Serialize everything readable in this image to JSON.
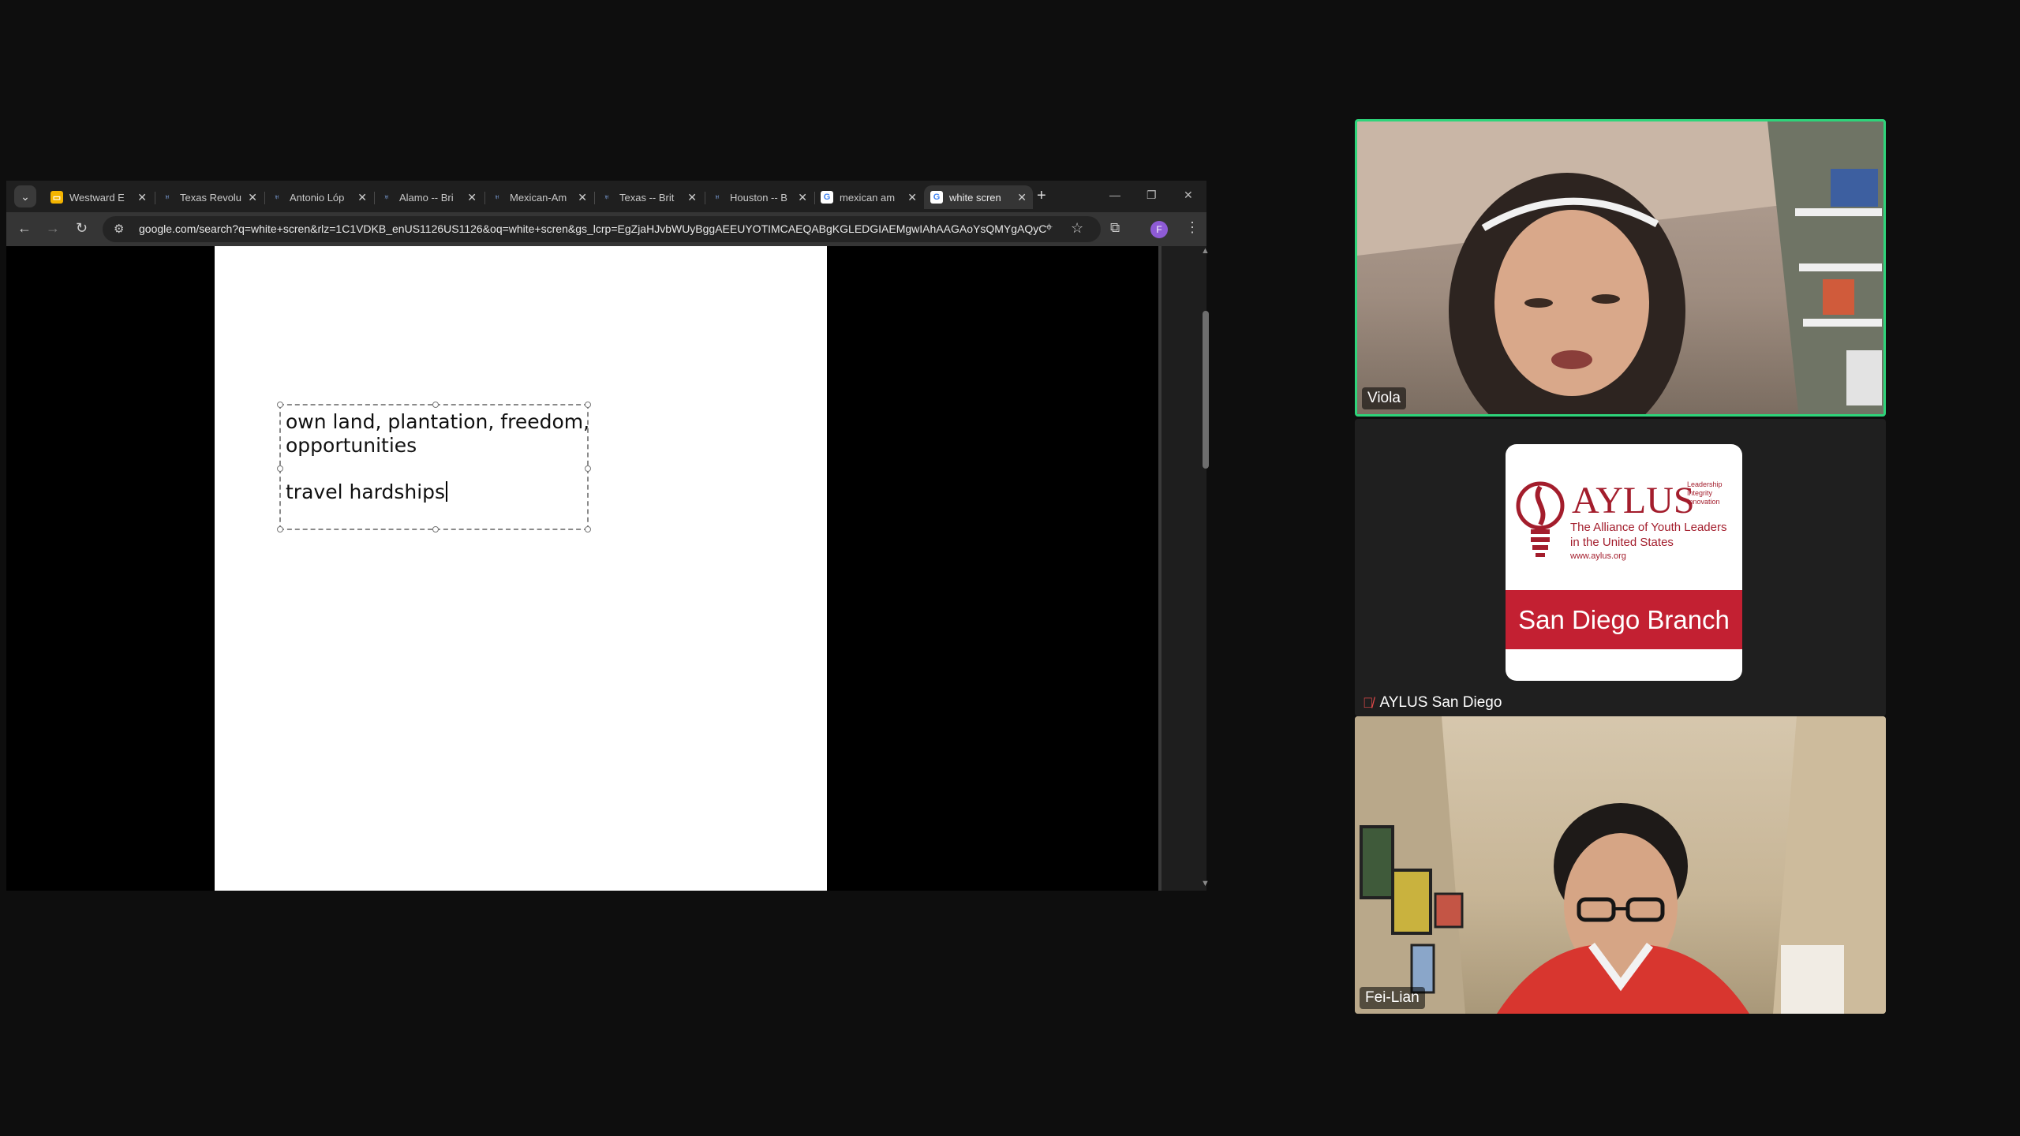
{
  "browser": {
    "tabs": [
      {
        "title": "Westward E",
        "favicon": "slides-icon",
        "active": false
      },
      {
        "title": "Texas Revolu",
        "favicon": "britannica-icon",
        "active": false
      },
      {
        "title": "Antonio Lóp",
        "favicon": "britannica-icon",
        "active": false
      },
      {
        "title": "Alamo -- Bri",
        "favicon": "britannica-icon",
        "active": false
      },
      {
        "title": "Mexican-Am",
        "favicon": "britannica-icon",
        "active": false
      },
      {
        "title": "Texas -- Brit",
        "favicon": "britannica-icon",
        "active": false
      },
      {
        "title": "Houston -- B",
        "favicon": "britannica-icon",
        "active": false
      },
      {
        "title": "mexican am",
        "favicon": "google-icon",
        "active": false
      },
      {
        "title": "white scren",
        "favicon": "google-icon",
        "active": true
      }
    ],
    "new_tab_symbol": "+",
    "url": "google.com/search?q=white+scren&rlz=1C1VDKB_enUS1126US1126&oq=white+scren&gs_lcrp=EgZjaHJvbWUyBggAEEUYOTIMCAEQABgKGLEDGIAEMgwIAhAAGAoYsQMYgAQyC...",
    "profile_initial": "F"
  },
  "slide": {
    "lines": [
      "own land, plantation, freedom,",
      "opportunities",
      "travel hardships"
    ]
  },
  "participants": [
    {
      "name": "Viola",
      "speaking": true,
      "muted": false
    },
    {
      "name": "AYLUS San Diego",
      "speaking": false,
      "muted": true
    },
    {
      "name": "Fei-Lian",
      "speaking": false,
      "muted": false
    }
  ],
  "logo": {
    "name": "AYLUS",
    "tagline": [
      "Leadership",
      "Integrity",
      "Innovation"
    ],
    "subtitle": [
      "The Alliance of Youth Leaders",
      "in the United States"
    ],
    "url": "www.aylus.org",
    "branch": "San Diego Branch",
    "brand_color": "#c32032"
  },
  "colors": {
    "speaking_border": "#2ed47a",
    "background": "#0e0e0e"
  }
}
